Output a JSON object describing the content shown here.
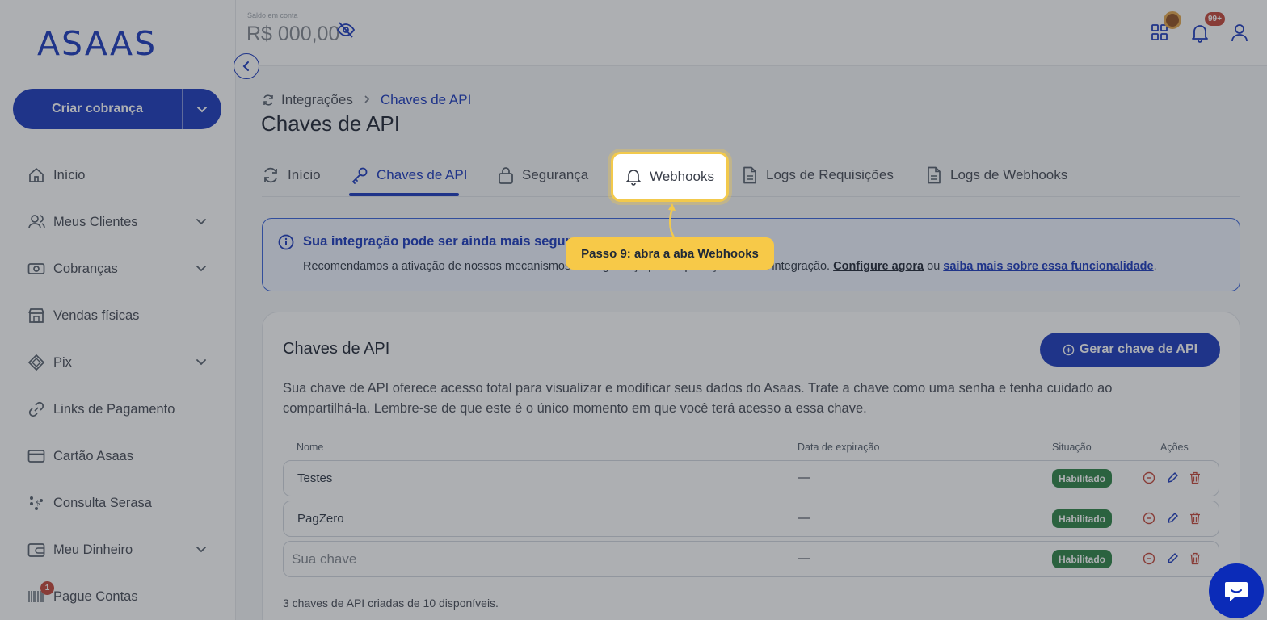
{
  "brand": {
    "logo_text": "ASAAS",
    "primary_color": "#0b2bb8"
  },
  "sidebar": {
    "cta_label": "Criar cobrança",
    "items": [
      {
        "label": "Início",
        "icon": "home-icon",
        "expandable": false
      },
      {
        "label": "Meus Clientes",
        "icon": "users-icon",
        "expandable": true
      },
      {
        "label": "Cobranças",
        "icon": "money-icon",
        "expandable": true
      },
      {
        "label": "Vendas físicas",
        "icon": "store-icon",
        "expandable": false
      },
      {
        "label": "Pix",
        "icon": "pix-icon",
        "expandable": true
      },
      {
        "label": "Links de Pagamento",
        "icon": "link-icon",
        "expandable": false
      },
      {
        "label": "Cartão Asaas",
        "icon": "card-icon",
        "expandable": false
      },
      {
        "label": "Consulta Serasa",
        "icon": "serasa-icon",
        "expandable": false
      },
      {
        "label": "Meu Dinheiro",
        "icon": "wallet-icon",
        "expandable": true
      },
      {
        "label": "Pague Contas",
        "icon": "barcode-icon",
        "expandable": false,
        "badge": "1"
      }
    ]
  },
  "topbar": {
    "balance_label": "Saldo em conta",
    "balance": "R$ 000,00",
    "notifications_badge": "99+"
  },
  "breadcrumb": {
    "parent": "Integrações",
    "current": "Chaves de API"
  },
  "page_title": "Chaves de API",
  "tabs": [
    {
      "label": "Início",
      "icon": "refresh-icon"
    },
    {
      "label": "Chaves de API",
      "icon": "key-icon",
      "active": true
    },
    {
      "label": "Segurança",
      "icon": "lock-icon"
    },
    {
      "label": "Webhooks",
      "icon": "bell-icon"
    },
    {
      "label": "Logs de Requisições",
      "icon": "document-icon"
    },
    {
      "label": "Logs de Webhooks",
      "icon": "document-icon"
    }
  ],
  "info_banner": {
    "title": "Sua integração pode ser ainda mais segura",
    "text_before": "Recomendamos a ativação de nossos mecanismos de segurança para a proteção da sua integração. ",
    "configure_link": "Configure agora",
    "middle": " ou ",
    "learn_link": "saiba mais sobre essa funcionalidade",
    "end": "."
  },
  "api_keys_card": {
    "title": "Chaves de API",
    "generate_button": "Gerar chave de API",
    "description": "Sua chave de API oferece acesso total para visualizar e modificar seus dados do Asaas. Trate a chave como uma senha e tenha cuidado ao compartilhá-la. Lembre-se de que este é o único momento em que você terá acesso a essa chave.",
    "columns": [
      "Nome",
      "Data de expiração",
      "Situação",
      "Ações"
    ],
    "rows": [
      {
        "name": "Testes",
        "expiration": "—",
        "status": "Habilitado"
      },
      {
        "name": "PagZero",
        "expiration": "—",
        "status": "Habilitado"
      },
      {
        "name": "",
        "name_placeholder": "Sua chave",
        "expiration": "—",
        "status": "Habilitado"
      }
    ],
    "footer": "3 chaves de API criadas de 10 disponíveis."
  },
  "tutorial": {
    "tooltip": "Passo 9: abra a aba Webhooks",
    "highlight_color": "#f2c94c"
  }
}
